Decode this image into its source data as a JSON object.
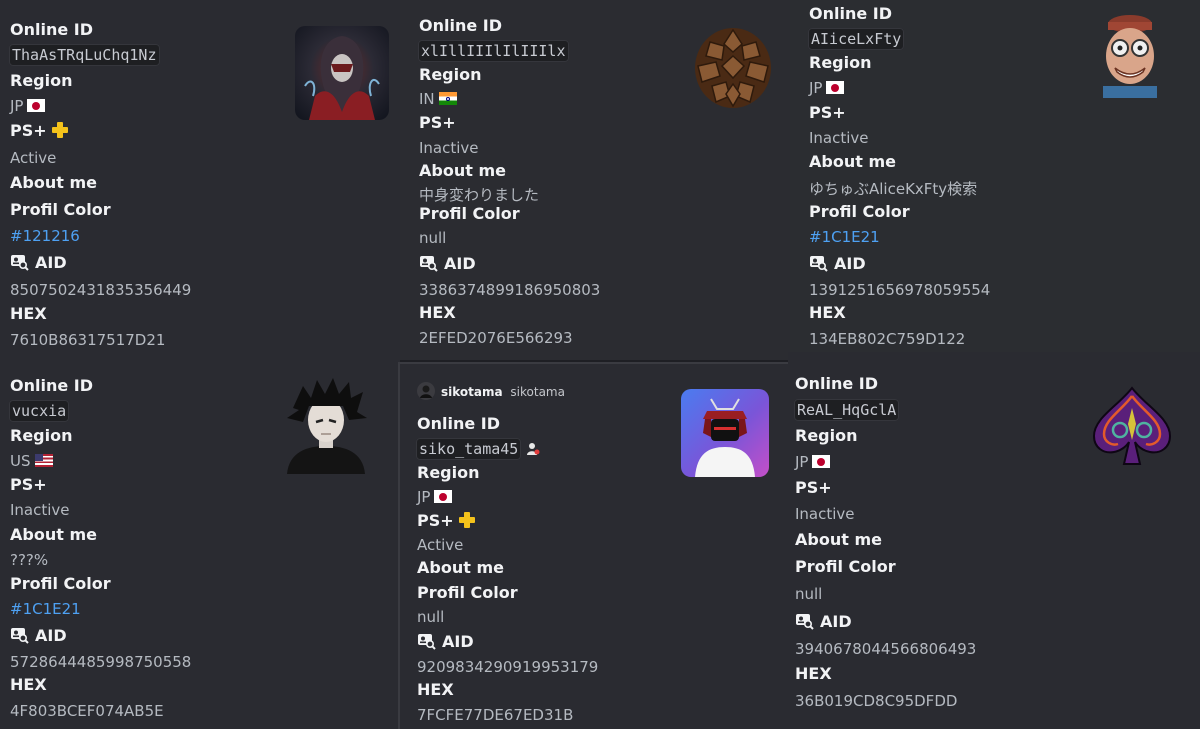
{
  "labels": {
    "online_id": "Online ID",
    "region": "Region",
    "ps_plus": "PS+",
    "about_me": "About me",
    "profil_color": "Profil Color",
    "aid": "AID",
    "hex": "HEX"
  },
  "cards": [
    {
      "online_id": "ThaAsTRqLuChq1Nz",
      "region": "JP",
      "region_flag": "flag-jp",
      "ps_plus_icon": "ps-plus-icon",
      "ps_plus": "Active",
      "about_me": "",
      "profil_color": "#121216",
      "aid": "8507502431835356449",
      "hex": "7610B86317517D21",
      "avatar": "hooded-warrior-avatar"
    },
    {
      "online_id": "xlIllIIIlIlIIIlx",
      "region": "IN",
      "region_flag": "flag-in",
      "ps_plus": "Inactive",
      "about_me": "中身変わりました",
      "profil_color": "null",
      "aid": "3386374899186950803",
      "hex": "2EFED2076E566293",
      "avatar": "pinecone-avatar"
    },
    {
      "online_id": "AIiceLxFty",
      "region": "JP",
      "region_flag": "flag-jp",
      "ps_plus": "Inactive",
      "about_me": "ゆちゅぶAliceKxFty検索",
      "profil_color": "#1C1E21",
      "aid": "1391251656978059554",
      "hex": "134EB802C759D122",
      "avatar": "cartoon-old-man-avatar"
    },
    {
      "online_id": "vucxia",
      "region": "US",
      "region_flag": "flag-us",
      "ps_plus": "Inactive",
      "about_me": "???%",
      "profil_color": "#1C1E21",
      "aid": "5728644485998750558",
      "hex": "4F803BCEF074AB5E",
      "avatar": "anime-boy-avatar"
    },
    {
      "header_name": "sikotama",
      "header_handle": "sikotama",
      "online_id": "siko_tama45",
      "region": "JP",
      "region_flag": "flag-jp",
      "ps_plus_icon": "ps-plus-icon",
      "ps_plus": "Active",
      "about_me": "",
      "profil_color": "null",
      "aid": "9209834290919953179",
      "hex": "7FCFE77DE67ED31B",
      "avatar": "samurai-figure-avatar"
    },
    {
      "online_id": "ReAL_HqGclA",
      "region": "JP",
      "region_flag": "flag-jp",
      "ps_plus": "Inactive",
      "about_me": "",
      "profil_color": "null",
      "aid": "3940678044566806493",
      "hex": "36B019CD8C95DFDD",
      "avatar": "ornate-spade-avatar"
    }
  ],
  "colors": {
    "link": "#4ea1f3",
    "ps_plus_gold": "#f4c21b",
    "background": "#2b2d31"
  }
}
